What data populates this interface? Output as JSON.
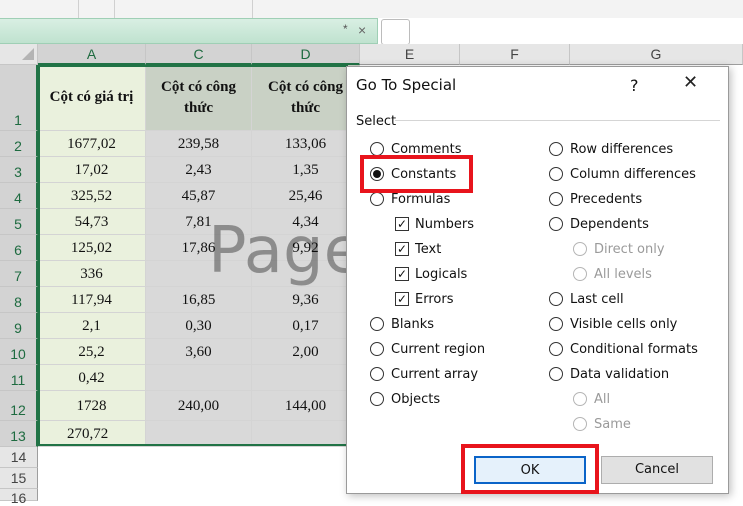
{
  "formula_bar": {
    "star": "*",
    "close": "×"
  },
  "columns": [
    "A",
    "C",
    "D",
    "E",
    "F",
    "G"
  ],
  "rows": [
    "1",
    "2",
    "3",
    "4",
    "5",
    "6",
    "7",
    "8",
    "9",
    "10",
    "11",
    "12",
    "13",
    "14",
    "15",
    "16"
  ],
  "headers": {
    "a": "Cột có giá trị",
    "c": "Cột có công thức",
    "d": "Cột có công thức"
  },
  "table": [
    [
      "1677,02",
      "239,58",
      "133,06"
    ],
    [
      "17,02",
      "2,43",
      "1,35"
    ],
    [
      "325,52",
      "45,87",
      "25,46"
    ],
    [
      "54,73",
      "7,81",
      "4,34"
    ],
    [
      "125,02",
      "17,86",
      "9,92"
    ],
    [
      "336",
      "",
      ""
    ],
    [
      "117,94",
      "16,85",
      "9,36"
    ],
    [
      "2,1",
      "0,30",
      "0,17"
    ],
    [
      "25,2",
      "3,60",
      "2,00"
    ],
    [
      "0,42",
      "",
      ""
    ],
    [
      "1728",
      "240,00",
      "144,00"
    ],
    [
      "270,72",
      "",
      ""
    ]
  ],
  "watermark": "Page",
  "dialog": {
    "title": "Go To Special",
    "help": "?",
    "close": "✕",
    "group_label": "Select",
    "left_options": {
      "comments": "Comments",
      "constants": "Constants",
      "formulas": "Formulas",
      "numbers": "Numbers",
      "text": "Text",
      "logicals": "Logicals",
      "errors": "Errors",
      "blanks": "Blanks",
      "current_region": "Current region",
      "current_array": "Current array",
      "objects": "Objects"
    },
    "right_options": {
      "row_differences": "Row differences",
      "column_differences": "Column differences",
      "precedents": "Precedents",
      "dependents": "Dependents",
      "direct_only": "Direct only",
      "all_levels": "All levels",
      "last_cell": "Last cell",
      "visible_cells_only": "Visible cells only",
      "conditional_formats": "Conditional formats",
      "data_validation": "Data validation",
      "all": "All",
      "same": "Same"
    },
    "selected": "Constants",
    "ok": "OK",
    "cancel": "Cancel",
    "highlight_color": "#e8141c"
  }
}
